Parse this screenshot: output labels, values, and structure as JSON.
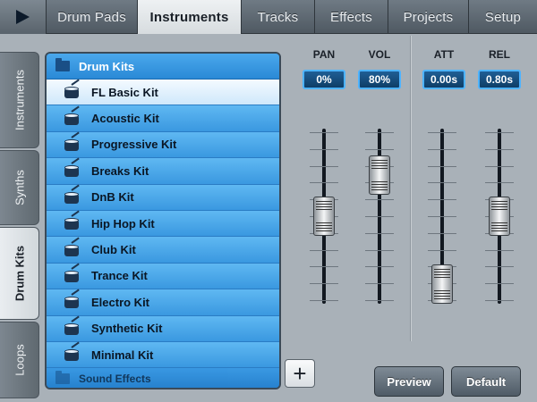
{
  "top_tabs": [
    {
      "label": "Drum Pads"
    },
    {
      "label": "Instruments"
    },
    {
      "label": "Tracks"
    },
    {
      "label": "Effects"
    },
    {
      "label": "Projects"
    },
    {
      "label": "Setup"
    }
  ],
  "active_top_tab": "Instruments",
  "side_tabs": [
    {
      "label": "Instruments"
    },
    {
      "label": "Synths"
    },
    {
      "label": "Drum Kits"
    },
    {
      "label": "Loops"
    }
  ],
  "active_side_tab": "Drum Kits",
  "list": {
    "header": "Drum Kits",
    "items": [
      {
        "label": "FL Basic Kit"
      },
      {
        "label": "Acoustic Kit"
      },
      {
        "label": "Progressive Kit"
      },
      {
        "label": "Breaks Kit"
      },
      {
        "label": "DnB Kit"
      },
      {
        "label": "Hip Hop Kit"
      },
      {
        "label": "Club Kit"
      },
      {
        "label": "Trance Kit"
      },
      {
        "label": "Electro Kit"
      },
      {
        "label": "Synthetic Kit"
      },
      {
        "label": "Minimal Kit"
      }
    ],
    "selected": "FL Basic Kit",
    "footer": "Sound Effects"
  },
  "controls": {
    "pan": {
      "label": "PAN",
      "value": "0%",
      "level": 0.5
    },
    "vol": {
      "label": "VOL",
      "value": "80%",
      "level": 0.8
    },
    "att": {
      "label": "ATT",
      "value": "0.00s",
      "level": 0.0
    },
    "rel": {
      "label": "REL",
      "value": "0.80s",
      "level": 0.5
    }
  },
  "buttons": {
    "add": "+",
    "preview": "Preview",
    "default": "Default"
  },
  "colors": {
    "accent": "#4db3ff",
    "list_blue": "#3a98e0"
  }
}
